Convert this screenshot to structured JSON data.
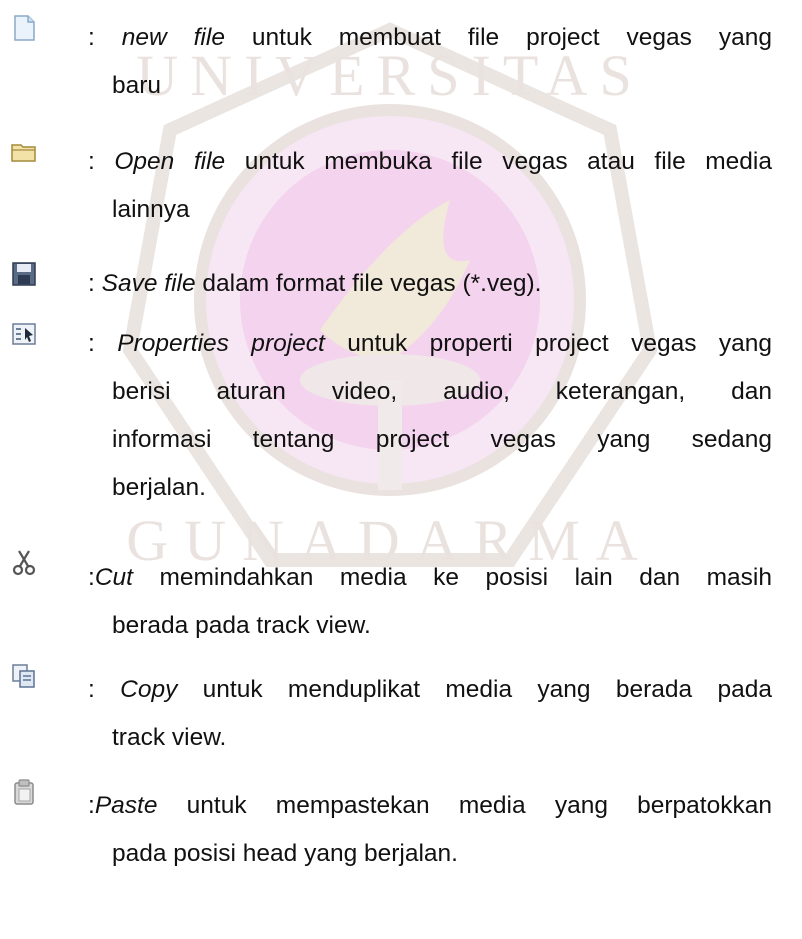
{
  "items": [
    {
      "icon": "new-file-icon",
      "sep": ": ",
      "term": "new file",
      "lines": [
        "  untuk membuat file project vegas yang",
        "baru"
      ]
    },
    {
      "icon": "open-folder-icon",
      "sep": ": ",
      "term": "Open file",
      "lines": [
        " untuk membuka file vegas atau file media",
        "lainnya"
      ]
    },
    {
      "icon": "save-disk-icon",
      "sep": ": ",
      "term": "Save file",
      "lines": [
        " dalam format file vegas (*.veg)."
      ]
    },
    {
      "icon": "properties-icon",
      "sep": ": ",
      "term": "Properties project",
      "lines": [
        " untuk properti project vegas yang",
        "berisi aturan video, audio, keterangan, dan",
        "informasi tentang project vegas yang sedang",
        "berjalan."
      ]
    },
    {
      "icon": "scissors-icon",
      "sep": ":",
      "term": "Cut",
      "lines": [
        "  memindahkan media ke posisi lain dan masih",
        "berada pada track view."
      ]
    },
    {
      "icon": "copy-icon",
      "sep": ": ",
      "term": "Copy",
      "lines": [
        " untuk menduplikat media yang berada pada",
        "track view."
      ]
    },
    {
      "icon": "paste-clipboard-icon",
      "sep": ":",
      "term": "Paste",
      "lines": [
        " untuk mempastekan media yang berpatokkan",
        "pada posisi head yang berjalan."
      ]
    }
  ],
  "watermark": {
    "text_top": "UNIVERSITAS",
    "text_bottom": "GUNADARMA",
    "colors": {
      "ring": "#e6e0dc",
      "center": "#f3c9ec"
    }
  }
}
